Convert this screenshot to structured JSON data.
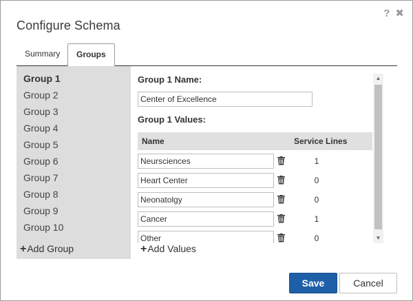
{
  "dialog": {
    "title": "Configure Schema",
    "help_icon": "?",
    "close_icon": "✖"
  },
  "tabs": [
    {
      "label": "Summary",
      "active": false
    },
    {
      "label": "Groups",
      "active": true
    }
  ],
  "sidebar": {
    "groups": [
      "Group 1",
      "Group 2",
      "Group 3",
      "Group 4",
      "Group 5",
      "Group 6",
      "Group 7",
      "Group 8",
      "Group 9",
      "Group 10"
    ],
    "active_index": 0,
    "add_label": "Add Group"
  },
  "content": {
    "name_label": "Group 1 Name:",
    "name_value": "Center of Excellence",
    "values_label": "Group 1 Values:",
    "col_name": "Name",
    "col_service_lines": "Service Lines",
    "values": [
      {
        "name": "Neursciences",
        "service_lines": "1"
      },
      {
        "name": "Heart Center",
        "service_lines": "0"
      },
      {
        "name": "Neonatolgy",
        "service_lines": "0"
      },
      {
        "name": "Cancer",
        "service_lines": "1"
      },
      {
        "name": "Other",
        "service_lines": "0"
      }
    ],
    "add_values_label": "Add Values"
  },
  "footer": {
    "save_label": "Save",
    "cancel_label": "Cancel"
  },
  "colors": {
    "primary": "#1f5fa8",
    "sidebar_bg": "#dddddd",
    "header_bg": "#e0e0e0"
  }
}
